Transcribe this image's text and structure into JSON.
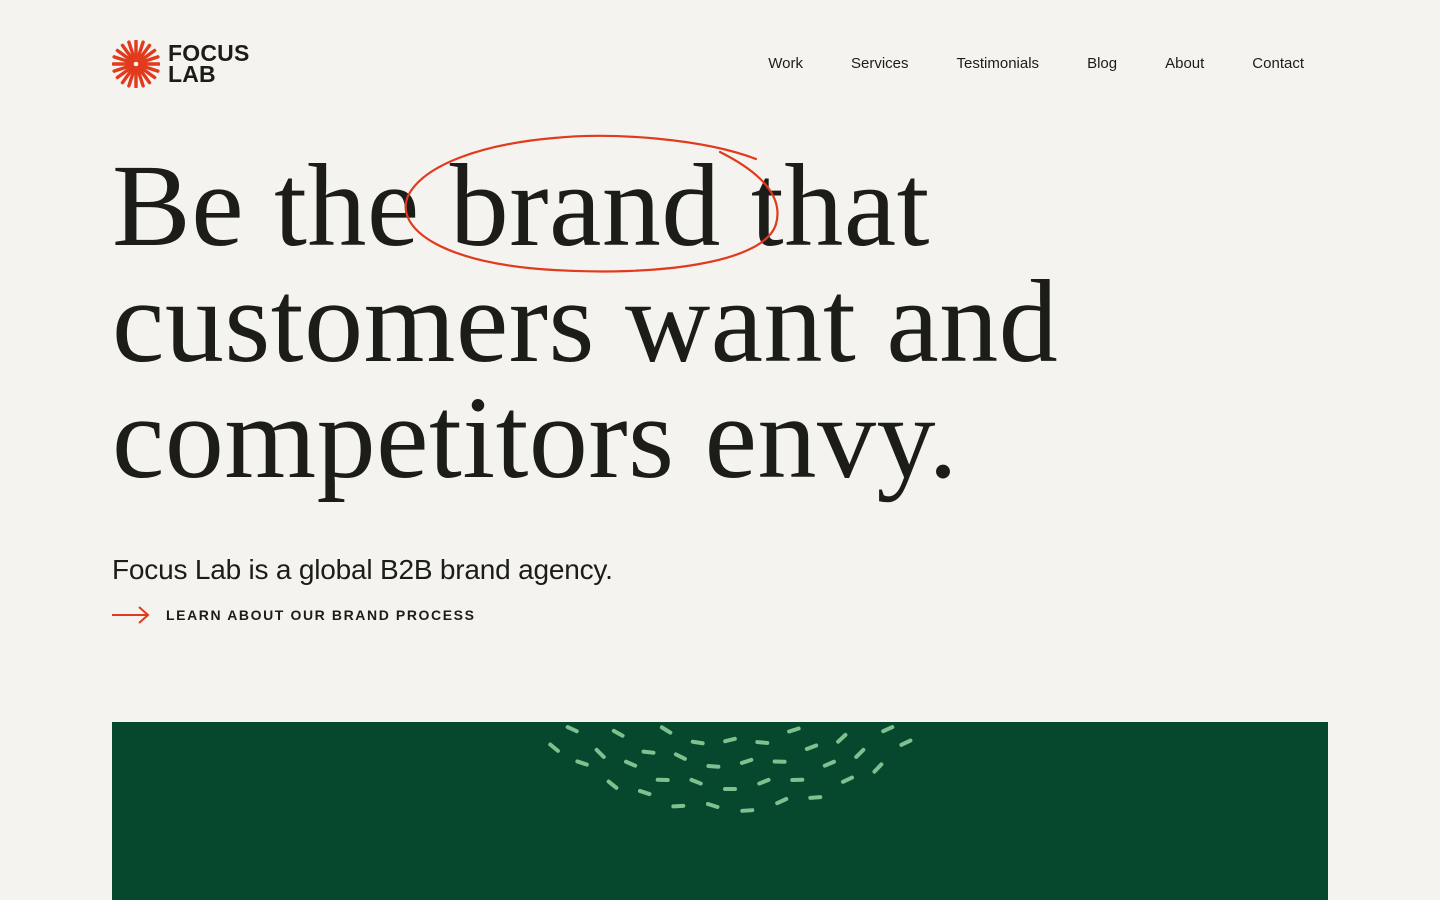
{
  "header": {
    "logo_line1": "FOCUS",
    "logo_line2": "LAB",
    "logo_icon": "starburst-icon",
    "nav": [
      {
        "label": "Work"
      },
      {
        "label": "Services"
      },
      {
        "label": "Testimonials"
      },
      {
        "label": "Blog"
      },
      {
        "label": "About"
      },
      {
        "label": "Contact"
      }
    ]
  },
  "hero": {
    "headline_part1": "Be the ",
    "headline_highlight": "brand",
    "headline_part2": " that",
    "headline_line2": "customers want and",
    "headline_line3": "competitors envy.",
    "subhead": "Focus Lab is a global B2B brand agency.",
    "cta_label": "LEARN ABOUT OUR BRAND PROCESS",
    "cta_icon": "arrow-right-icon"
  },
  "colors": {
    "accent": "#e13a1c",
    "background": "#f4f3ef",
    "text": "#1c1c19",
    "panel": "#06482e",
    "panel_marks": "#7fc08f"
  }
}
